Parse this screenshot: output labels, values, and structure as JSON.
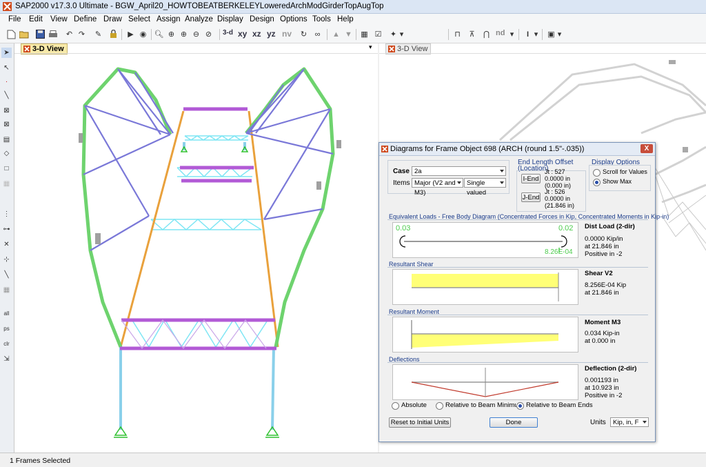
{
  "window": {
    "title": "SAP2000 v17.3.0 Ultimate  - BGW_April20_HOWTOBEATBERKELEYLoweredArchModGirderTopAugTop"
  },
  "menu": [
    "File",
    "Edit",
    "View",
    "Define",
    "Draw",
    "Select",
    "Assign",
    "Analyze",
    "Display",
    "Design",
    "Options",
    "Tools",
    "Help"
  ],
  "toolbar": {
    "view_buttons": [
      "3-d",
      "xy",
      "xz",
      "yz",
      "nv"
    ],
    "nd_label": "nd"
  },
  "views": {
    "left_tab": "3-D View",
    "right_tab": "3-D View"
  },
  "status": {
    "text": "1 Frames Selected"
  },
  "dialog": {
    "title": "Diagrams for Frame Object 698  (ARCH (round 1.5\"-.035))",
    "close": "X",
    "case_label": "Case",
    "case_value": "2a",
    "items_label": "Items",
    "items_value": "Major (V2 and M3)",
    "items_mode": "Single valued",
    "end_offset": {
      "title_line1": "End Length Offset",
      "title_line2": "(Location)",
      "iend_button": "I-End",
      "jend_button": "J-End",
      "i_jt": "Jt : 527",
      "i_val1": "0.0000 in",
      "i_val2": "(0.000 in)",
      "j_jt": "Jt : 526",
      "j_val1": "0.0000 in",
      "j_val2": "(21.846 in)"
    },
    "display_options": {
      "title": "Display Options",
      "scroll": "Scroll for Values",
      "show_max": "Show Max",
      "selected": "show_max"
    },
    "equiv_loads": {
      "title": "Equivalent Loads - Free Body Diagram  (Concentrated Forces in Kip, Concentrated Moments in Kip-in)",
      "left_val": "0.03",
      "right_val": "0.02",
      "bottom_val": "8.26E-04",
      "side_title": "Dist Load (2-dir)",
      "side_l1": "0.0000 Kip/in",
      "side_l2": "at 21.846 in",
      "side_l3": "Positive in -2"
    },
    "shear": {
      "title": "Resultant Shear",
      "side_title": "Shear V2",
      "side_l1": "8.256E-04 Kip",
      "side_l2": "at 21.846 in"
    },
    "moment": {
      "title": "Resultant Moment",
      "side_title": "Moment M3",
      "side_l1": "0.034 Kip-in",
      "side_l2": "at 0.000 in"
    },
    "deflection": {
      "title": "Deflections",
      "side_title": "Deflection (2-dir)",
      "side_l1": "0.001193 in",
      "side_l2": "at 10.923 in",
      "side_l3": "Positive in -2",
      "opt_absolute": "Absolute",
      "opt_rel_min": "Relative to Beam Minimum",
      "opt_rel_ends": "Relative to Beam Ends",
      "selected": "opt_rel_ends"
    },
    "reset_button": "Reset to Initial Units",
    "done_button": "Done",
    "units_label": "Units",
    "units_value": "Kip, in, F"
  },
  "colors": {
    "arch": "#6ed36e",
    "brace": "#7a78d8",
    "girder": "#b25ad6",
    "truss": "#7fe6f4",
    "column": "#8ad0ea",
    "rail": "#e9a13c",
    "diagram_fill": "#ffff77",
    "deflection_line": "#c0392b",
    "load_value": "#4ccb4c"
  },
  "icons": {
    "app": "sap2000-logo-icon",
    "view_close": "close-view-icon"
  }
}
